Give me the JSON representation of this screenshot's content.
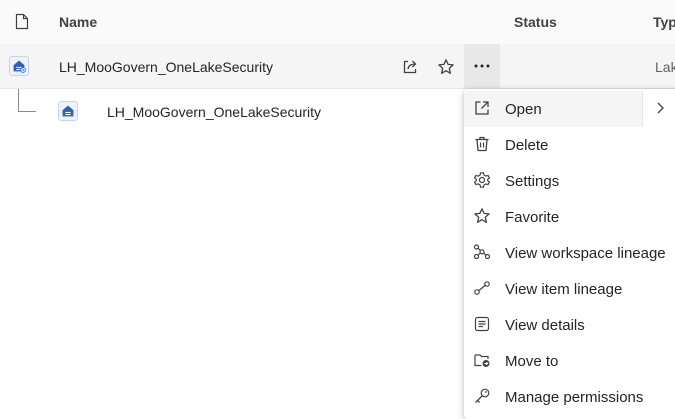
{
  "table": {
    "columns": {
      "name": "Name",
      "status": "Status",
      "type": "Typ"
    },
    "rows": [
      {
        "name": "LH_MooGovern_OneLakeSecurity",
        "type": "Lak"
      },
      {
        "name": "LH_MooGovern_OneLakeSecurity"
      }
    ]
  },
  "menu": {
    "items": [
      {
        "label": "Open",
        "icon": "open-external-icon"
      },
      {
        "label": "Delete",
        "icon": "trash-icon"
      },
      {
        "label": "Settings",
        "icon": "gear-icon"
      },
      {
        "label": "Favorite",
        "icon": "star-icon"
      },
      {
        "label": "View workspace lineage",
        "icon": "workspace-lineage-icon"
      },
      {
        "label": "View item lineage",
        "icon": "item-lineage-icon"
      },
      {
        "label": "View details",
        "icon": "details-icon"
      },
      {
        "label": "Move to",
        "icon": "folder-move-icon"
      },
      {
        "label": "Manage permissions",
        "icon": "key-icon"
      }
    ]
  },
  "colors": {
    "accent": "#2b5fb8",
    "selected_row": "#f5f5f5",
    "more_button_active": "#e8e8e8"
  }
}
